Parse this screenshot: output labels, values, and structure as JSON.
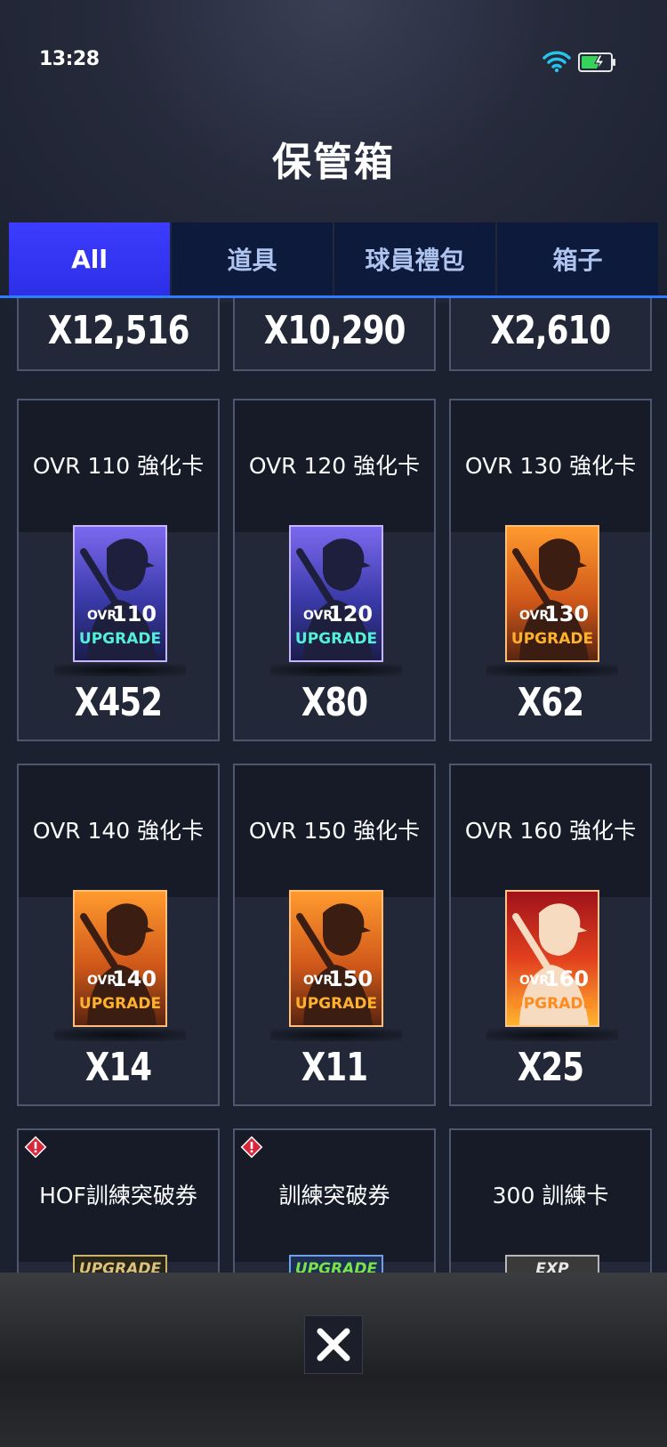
{
  "status_bar": {
    "time": "13:28"
  },
  "header": {
    "title": "保管箱"
  },
  "tabs": [
    {
      "label": "All",
      "active": true
    },
    {
      "label": "道具",
      "active": false
    },
    {
      "label": "球員禮包",
      "active": false
    },
    {
      "label": "箱子",
      "active": false
    }
  ],
  "top_row": [
    {
      "quantity": "X12,516"
    },
    {
      "quantity": "X10,290"
    },
    {
      "quantity": "X2,610"
    }
  ],
  "cards": [
    {
      "name": "OVR 110 強化卡",
      "quantity": "X452",
      "badge_ovr": "OVR",
      "badge_num": "110",
      "badge_text": "UPGRADE",
      "icon": "baseball-player-upgrade-card-icon"
    },
    {
      "name": "OVR 120 強化卡",
      "quantity": "X80",
      "badge_ovr": "OVR",
      "badge_num": "120",
      "badge_text": "UPGRADE",
      "icon": "baseball-player-upgrade-card-icon"
    },
    {
      "name": "OVR 130 強化卡",
      "quantity": "X62",
      "badge_ovr": "OVR",
      "badge_num": "130",
      "badge_text": "UPGRADE",
      "icon": "baseball-player-upgrade-card-icon"
    },
    {
      "name": "OVR 140 強化卡",
      "quantity": "X14",
      "badge_ovr": "OVR",
      "badge_num": "140",
      "badge_text": "UPGRADE",
      "icon": "baseball-player-upgrade-card-icon"
    },
    {
      "name": "OVR 150 強化卡",
      "quantity": "X11",
      "badge_ovr": "OVR",
      "badge_num": "150",
      "badge_text": "UPGRADE",
      "icon": "baseball-player-upgrade-card-icon"
    },
    {
      "name": "OVR 160 強化卡",
      "quantity": "X25",
      "badge_ovr": "OVR",
      "badge_num": "160",
      "badge_text": "UPGRADE",
      "icon": "baseball-player-upgrade-card-icon"
    }
  ],
  "bottom_row": [
    {
      "name": "HOF訓練突破券",
      "has_alert": true,
      "peek_text": "UPGRADE"
    },
    {
      "name": "訓練突破券",
      "has_alert": true,
      "peek_text": "UPGRADE"
    },
    {
      "name": "300 訓練卡",
      "has_alert": false,
      "peek_text": "EXP"
    }
  ],
  "colors": {
    "tab_active": "#2d2fe6",
    "tab_inactive": "#0d1a3c",
    "tab_underline": "#2f7cff",
    "purple_card": "#5b4bd6",
    "orange_card": "#e8761e",
    "red_card": "#c8201e",
    "upgrade_cyan": "#53f0d7",
    "upgrade_orange": "#ffb12e"
  }
}
